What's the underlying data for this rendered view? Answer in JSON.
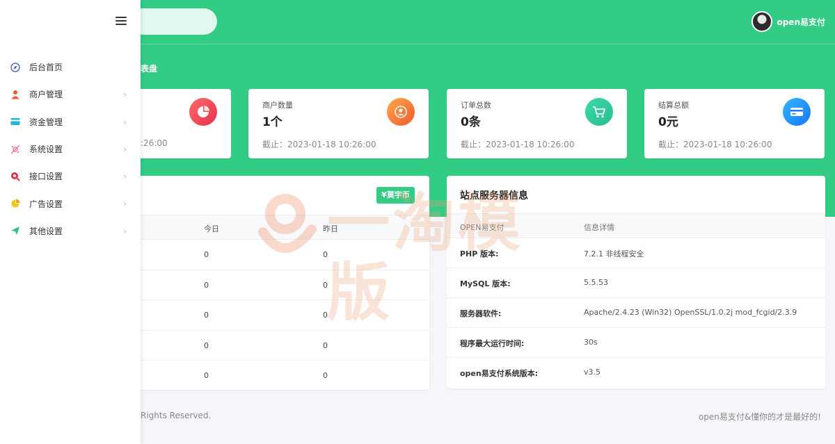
{
  "header": {
    "search_placeholder": "",
    "username": "open易支付"
  },
  "page": {
    "title": "表盘"
  },
  "stats": [
    {
      "label": "",
      "value": "",
      "date": ":26:00"
    },
    {
      "label": "商户数量",
      "value": "1个",
      "date": "截止：2023-01-18 10:26:00"
    },
    {
      "label": "订单总数",
      "value": "0条",
      "date": "截止：2023-01-18 10:26:00"
    },
    {
      "label": "结算总额",
      "value": "0元",
      "date": "截止：2023-01-18 10:26:00"
    }
  ],
  "left_panel": {
    "badge": "¥莫宇币",
    "columns": [
      "今日",
      "昨日"
    ],
    "rows": [
      [
        "0",
        "0"
      ],
      [
        "0",
        "0"
      ],
      [
        "0",
        "0"
      ],
      [
        "0",
        "0"
      ],
      [
        "0",
        "0"
      ]
    ]
  },
  "right_panel": {
    "title": "站点服务器信息",
    "columns": [
      "OPEN易支付",
      "信息详情"
    ],
    "rows": [
      {
        "key": "PHP 版本:",
        "value": "7.2.1 非线程安全"
      },
      {
        "key": "MySQL 版本:",
        "value": "5.5.53"
      },
      {
        "key": "服务器软件:",
        "value": "Apache/2.4.23 (Win32) OpenSSL/1.0.2j mod_fcgid/2.3.9"
      },
      {
        "key": "程序最大运行时间:",
        "value": "30s"
      },
      {
        "key": "open易支付系统版本:",
        "value": "v3.5"
      }
    ]
  },
  "footer": {
    "left": "Rights Reserved.",
    "right": "open易支付&懂你的才是最好的!"
  },
  "sidebar": {
    "items": [
      {
        "label": "后台首页",
        "icon": "compass-icon",
        "color": "#3f5bbf"
      },
      {
        "label": "商户管理",
        "icon": "user-icon",
        "color": "#f0592b"
      },
      {
        "label": "资金管理",
        "icon": "card-icon",
        "color": "#1fb5d6"
      },
      {
        "label": "系统设置",
        "icon": "satellite-icon",
        "color": "#f06a8a"
      },
      {
        "label": "接口设置",
        "icon": "plug-icon",
        "color": "#e8304a"
      },
      {
        "label": "广告设置",
        "icon": "pie-icon",
        "color": "#f5c518"
      },
      {
        "label": "其他设置",
        "icon": "send-icon",
        "color": "#2bbd8e"
      }
    ]
  },
  "watermark": {
    "text": "一淘模版"
  },
  "colors": {
    "brand": "#33cc85",
    "background": "#f4f6f9"
  }
}
